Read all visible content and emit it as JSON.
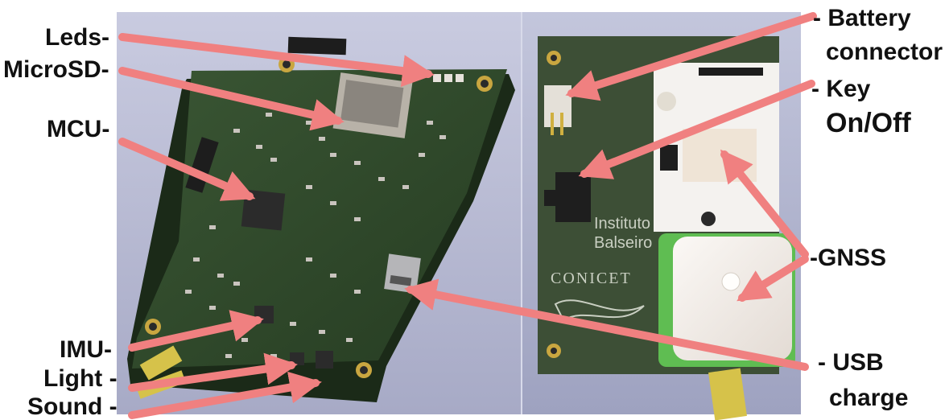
{
  "board_front": {
    "labels": {
      "leds": "Leds-",
      "microsd": "MicroSD-",
      "mcu": "MCU-",
      "imu": "IMU-",
      "light": "Light -",
      "sound": "Sound -"
    }
  },
  "board_back": {
    "silkscreen": {
      "institute_line1": "Instituto",
      "institute_line2": "Balseiro",
      "conicet": "CONICET"
    },
    "labels": {
      "battery_line1": "- Battery",
      "battery_line2": "connector",
      "key_line1": "- Key",
      "key_line2": "On/Off",
      "gnss": "-GNSS",
      "usb_line1": "- USB",
      "usb_line2": "charge"
    }
  },
  "colors": {
    "arrow": "#f08080",
    "pcb": "#2f4a2a",
    "background": "#b8bcd4",
    "gnss_patch": "#f2ece8"
  }
}
